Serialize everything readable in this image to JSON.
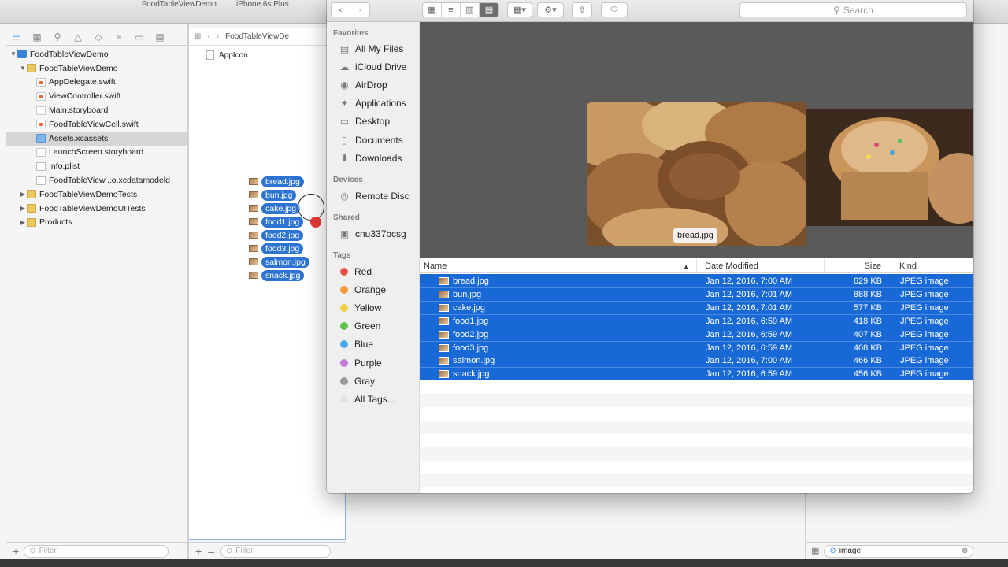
{
  "xcode": {
    "breadcrumb_top": [
      "FoodTableViewDemo",
      "iPhone 6s Plus"
    ],
    "navigator_tree": [
      {
        "label": "FoodTableViewDemo",
        "icon": "project",
        "depth": 0,
        "disclosure": "▼"
      },
      {
        "label": "FoodTableViewDemo",
        "icon": "folder",
        "depth": 1,
        "disclosure": "▼"
      },
      {
        "label": "AppDelegate.swift",
        "icon": "swift",
        "depth": 2,
        "disclosure": ""
      },
      {
        "label": "ViewController.swift",
        "icon": "swift",
        "depth": 2,
        "disclosure": ""
      },
      {
        "label": "Main.storyboard",
        "icon": "story",
        "depth": 2,
        "disclosure": ""
      },
      {
        "label": "FoodTableViewCell.swift",
        "icon": "swift",
        "depth": 2,
        "disclosure": ""
      },
      {
        "label": "Assets.xcassets",
        "icon": "assets",
        "depth": 2,
        "disclosure": "",
        "selected": true
      },
      {
        "label": "LaunchScreen.storyboard",
        "icon": "story",
        "depth": 2,
        "disclosure": ""
      },
      {
        "label": "Info.plist",
        "icon": "plist",
        "depth": 2,
        "disclosure": ""
      },
      {
        "label": "FoodTableView...o.xcdatamodeld",
        "icon": "data",
        "depth": 2,
        "disclosure": ""
      },
      {
        "label": "FoodTableViewDemoTests",
        "icon": "folder",
        "depth": 1,
        "disclosure": "▶"
      },
      {
        "label": "FoodTableViewDemoUITests",
        "icon": "folder",
        "depth": 1,
        "disclosure": "▶"
      },
      {
        "label": "Products",
        "icon": "folder",
        "depth": 1,
        "disclosure": "▶"
      }
    ],
    "navigator_filter_placeholder": "Filter",
    "asset_breadcrumb": "FoodTableViewDe",
    "asset_items": [
      "AppIcon"
    ],
    "asset_filter_placeholder": "Filter",
    "dragged_files": [
      "bread.jpg",
      "bun.jpg",
      "cake.jpg",
      "food1.jpg",
      "food2.jpg",
      "food3.jpg",
      "salmon.jpg",
      "snack.jpg"
    ],
    "library_search_value": "image"
  },
  "finder": {
    "search_placeholder": "Search",
    "sidebar": {
      "favorites_title": "Favorites",
      "favorites": [
        {
          "label": "All My Files",
          "icon": "all-files-icon",
          "glyph": "▤"
        },
        {
          "label": "iCloud Drive",
          "icon": "cloud-icon",
          "glyph": "☁"
        },
        {
          "label": "AirDrop",
          "icon": "airdrop-icon",
          "glyph": "◉"
        },
        {
          "label": "Applications",
          "icon": "applications-icon",
          "glyph": "✦"
        },
        {
          "label": "Desktop",
          "icon": "desktop-icon",
          "glyph": "▭"
        },
        {
          "label": "Documents",
          "icon": "documents-icon",
          "glyph": "▯"
        },
        {
          "label": "Downloads",
          "icon": "downloads-icon",
          "glyph": "⬇"
        }
      ],
      "devices_title": "Devices",
      "devices": [
        {
          "label": "Remote Disc",
          "icon": "disc-icon",
          "glyph": "◎"
        }
      ],
      "shared_title": "Shared",
      "shared": [
        {
          "label": "cnu337bcsg",
          "icon": "computer-icon",
          "glyph": "▣"
        }
      ],
      "tags_title": "Tags",
      "tags": [
        {
          "label": "Red",
          "color": "#e8524b"
        },
        {
          "label": "Orange",
          "color": "#f29c38"
        },
        {
          "label": "Yellow",
          "color": "#f2cf45"
        },
        {
          "label": "Green",
          "color": "#5fc04d"
        },
        {
          "label": "Blue",
          "color": "#4ca8ec"
        },
        {
          "label": "Purple",
          "color": "#c77bd9"
        },
        {
          "label": "Gray",
          "color": "#9a9a9a"
        },
        {
          "label": "All Tags...",
          "color": "#e3e3e3"
        }
      ]
    },
    "preview_caption": "bread.jpg",
    "columns": {
      "name": "Name",
      "date": "Date Modified",
      "size": "Size",
      "kind": "Kind"
    },
    "files": [
      {
        "name": "bread.jpg",
        "date": "Jan 12, 2016, 7:00 AM",
        "size": "629 KB",
        "kind": "JPEG image"
      },
      {
        "name": "bun.jpg",
        "date": "Jan 12, 2016, 7:01 AM",
        "size": "888 KB",
        "kind": "JPEG image"
      },
      {
        "name": "cake.jpg",
        "date": "Jan 12, 2016, 7:01 AM",
        "size": "577 KB",
        "kind": "JPEG image"
      },
      {
        "name": "food1.jpg",
        "date": "Jan 12, 2016, 6:59 AM",
        "size": "418 KB",
        "kind": "JPEG image"
      },
      {
        "name": "food2.jpg",
        "date": "Jan 12, 2016, 6:59 AM",
        "size": "407 KB",
        "kind": "JPEG image"
      },
      {
        "name": "food3.jpg",
        "date": "Jan 12, 2016, 6:59 AM",
        "size": "408 KB",
        "kind": "JPEG image"
      },
      {
        "name": "salmon.jpg",
        "date": "Jan 12, 2016, 7:00 AM",
        "size": "466 KB",
        "kind": "JPEG image"
      },
      {
        "name": "snack.jpg",
        "date": "Jan 12, 2016, 6:59 AM",
        "size": "456 KB",
        "kind": "JPEG image"
      }
    ],
    "selection_color": "#1869d6"
  }
}
